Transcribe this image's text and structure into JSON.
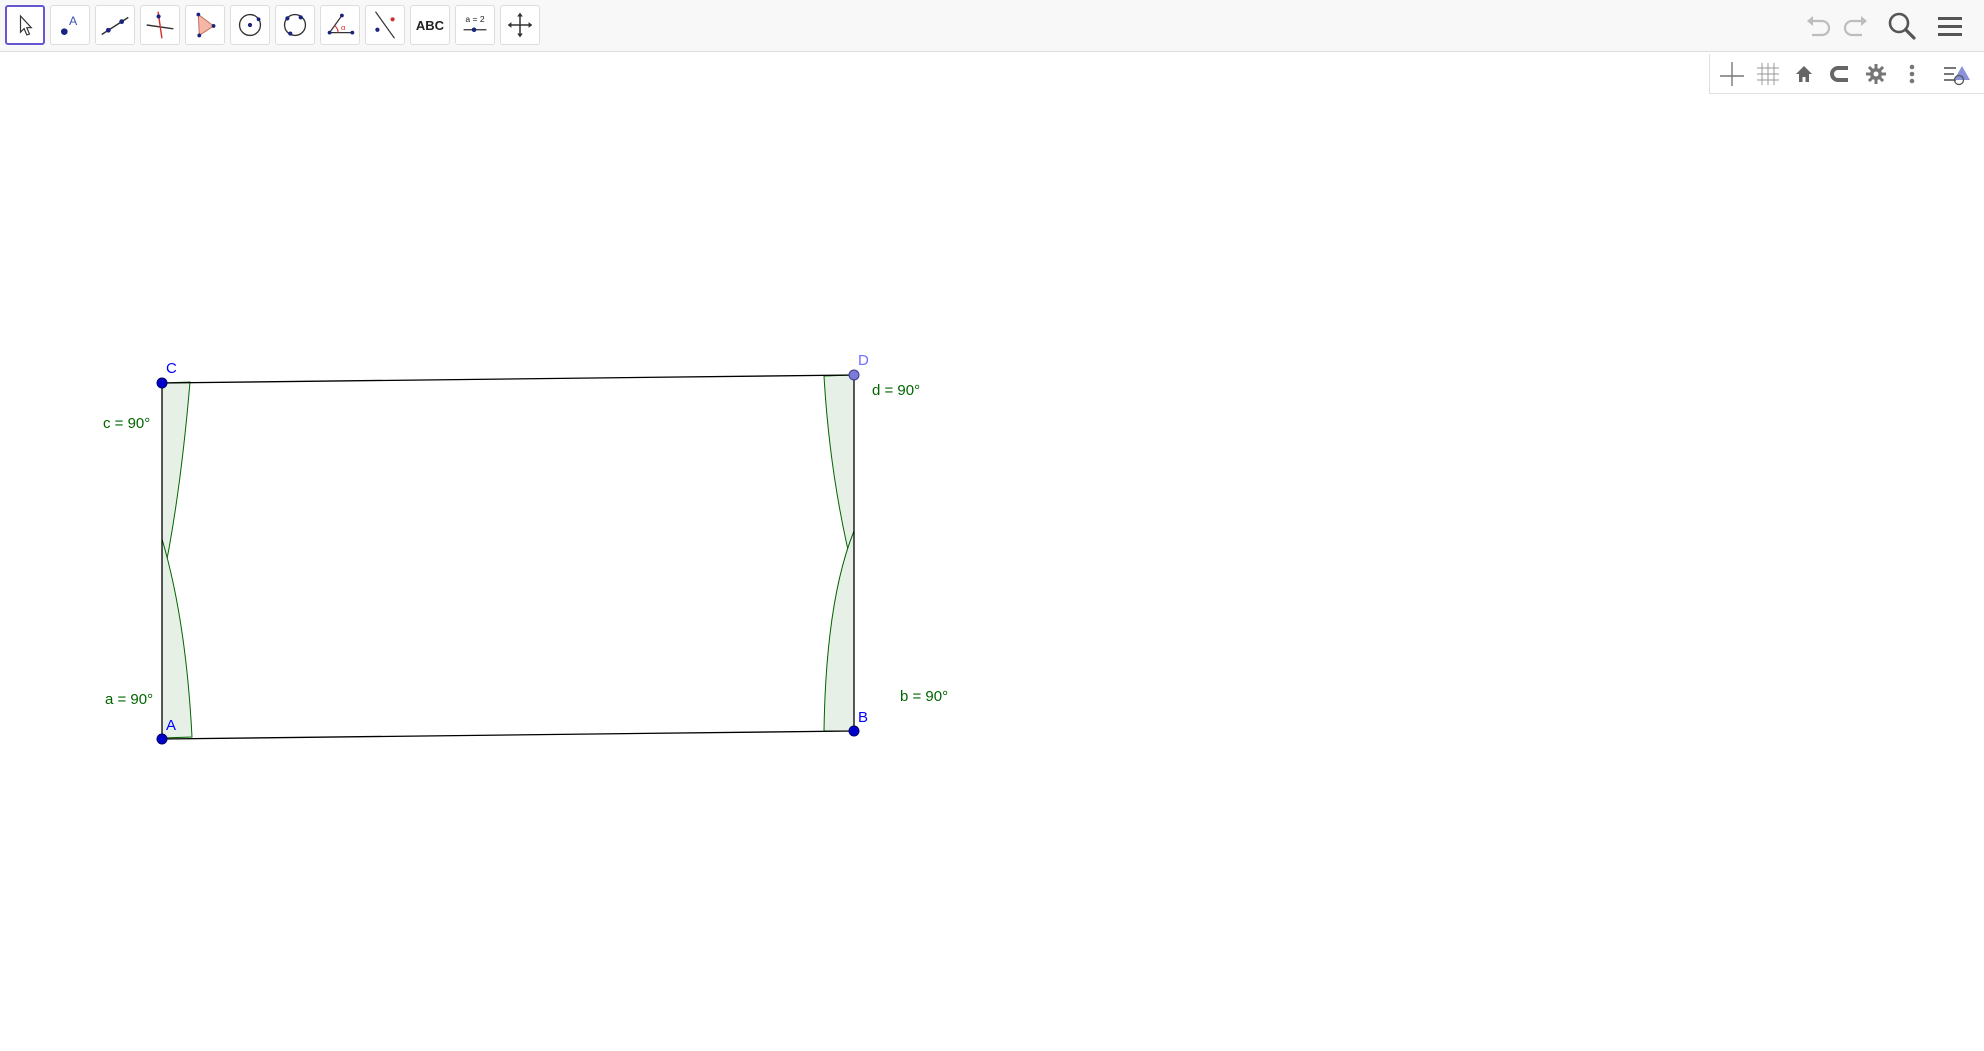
{
  "toolbar": {
    "tools": [
      {
        "name": "move-tool",
        "icon": "cursor-arrow-icon",
        "selected": true
      },
      {
        "name": "point-tool",
        "icon": "point-icon",
        "label": "A"
      },
      {
        "name": "line-tool",
        "icon": "line-icon"
      },
      {
        "name": "perpendicular-line-tool",
        "icon": "perpendicular-icon"
      },
      {
        "name": "polygon-tool",
        "icon": "polygon-icon"
      },
      {
        "name": "circle-center-point-tool",
        "icon": "circle-center-icon"
      },
      {
        "name": "circle-three-points-tool",
        "icon": "circle-three-points-icon"
      },
      {
        "name": "angle-tool",
        "icon": "angle-icon",
        "label": "α"
      },
      {
        "name": "reflect-tool",
        "icon": "reflect-icon"
      },
      {
        "name": "text-tool",
        "icon": "text-icon",
        "label": "ABC"
      },
      {
        "name": "slider-tool",
        "icon": "slider-icon",
        "label": "a = 2"
      },
      {
        "name": "move-graphics-view-tool",
        "icon": "move-arrows-icon"
      }
    ],
    "right": {
      "undo_icon": "undo-icon",
      "redo_icon": "redo-icon",
      "search_icon": "search-icon",
      "menu_icon": "hamburger-menu-icon"
    }
  },
  "style_bar": {
    "buttons": [
      "axes-icon",
      "grid-icon",
      "home-icon",
      "magnet-icon",
      "gear-icon",
      "more-vertical-icon",
      "toggle-style-bar-icon"
    ]
  },
  "construction": {
    "points": {
      "A": {
        "label": "A"
      },
      "B": {
        "label": "B"
      },
      "C": {
        "label": "C"
      },
      "D": {
        "label": "D"
      }
    },
    "angles": {
      "a": "a = 90°",
      "b": "b = 90°",
      "c": "c = 90°",
      "d": "d = 90°"
    }
  },
  "colors": {
    "point": "#0000cc",
    "point_selected": "#7b7bd8",
    "angle_fill": "#e6f0e6",
    "angle_stroke": "#006400",
    "segment": "#000000",
    "tool_selected_border": "#6557d2"
  }
}
